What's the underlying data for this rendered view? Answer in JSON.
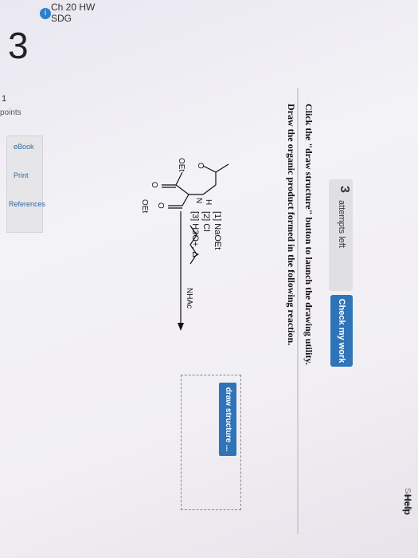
{
  "header": {
    "app_title": "Ch 20 HW SDG",
    "badge": "i",
    "saved": "Saved",
    "help": "Help"
  },
  "question": {
    "number": "3",
    "points_value": "1",
    "points_label": "points"
  },
  "sidebar": {
    "items": [
      {
        "label": "eBook"
      },
      {
        "label": "Print"
      },
      {
        "label": "References"
      }
    ]
  },
  "attempts": {
    "count": "3",
    "label": "attempts left"
  },
  "check_button": "Check my work",
  "instructions": {
    "line1": "Click the \"draw structure\" button to launch the drawing utility.",
    "line2": "Draw the organic product formed in the following reaction."
  },
  "reaction": {
    "reagent1": "[1] NaOEt",
    "reagent2": "[2] Cl",
    "reagent3": "[3] H3O+, Δ",
    "substituent": "NHAc",
    "labels": {
      "h": "H",
      "n": "N",
      "o_top": "O",
      "o_left": "O",
      "o_carbonyl": "O",
      "oet_top": "OEt",
      "oet_bottom": "OEt"
    }
  },
  "draw_button": "draw structure ..."
}
